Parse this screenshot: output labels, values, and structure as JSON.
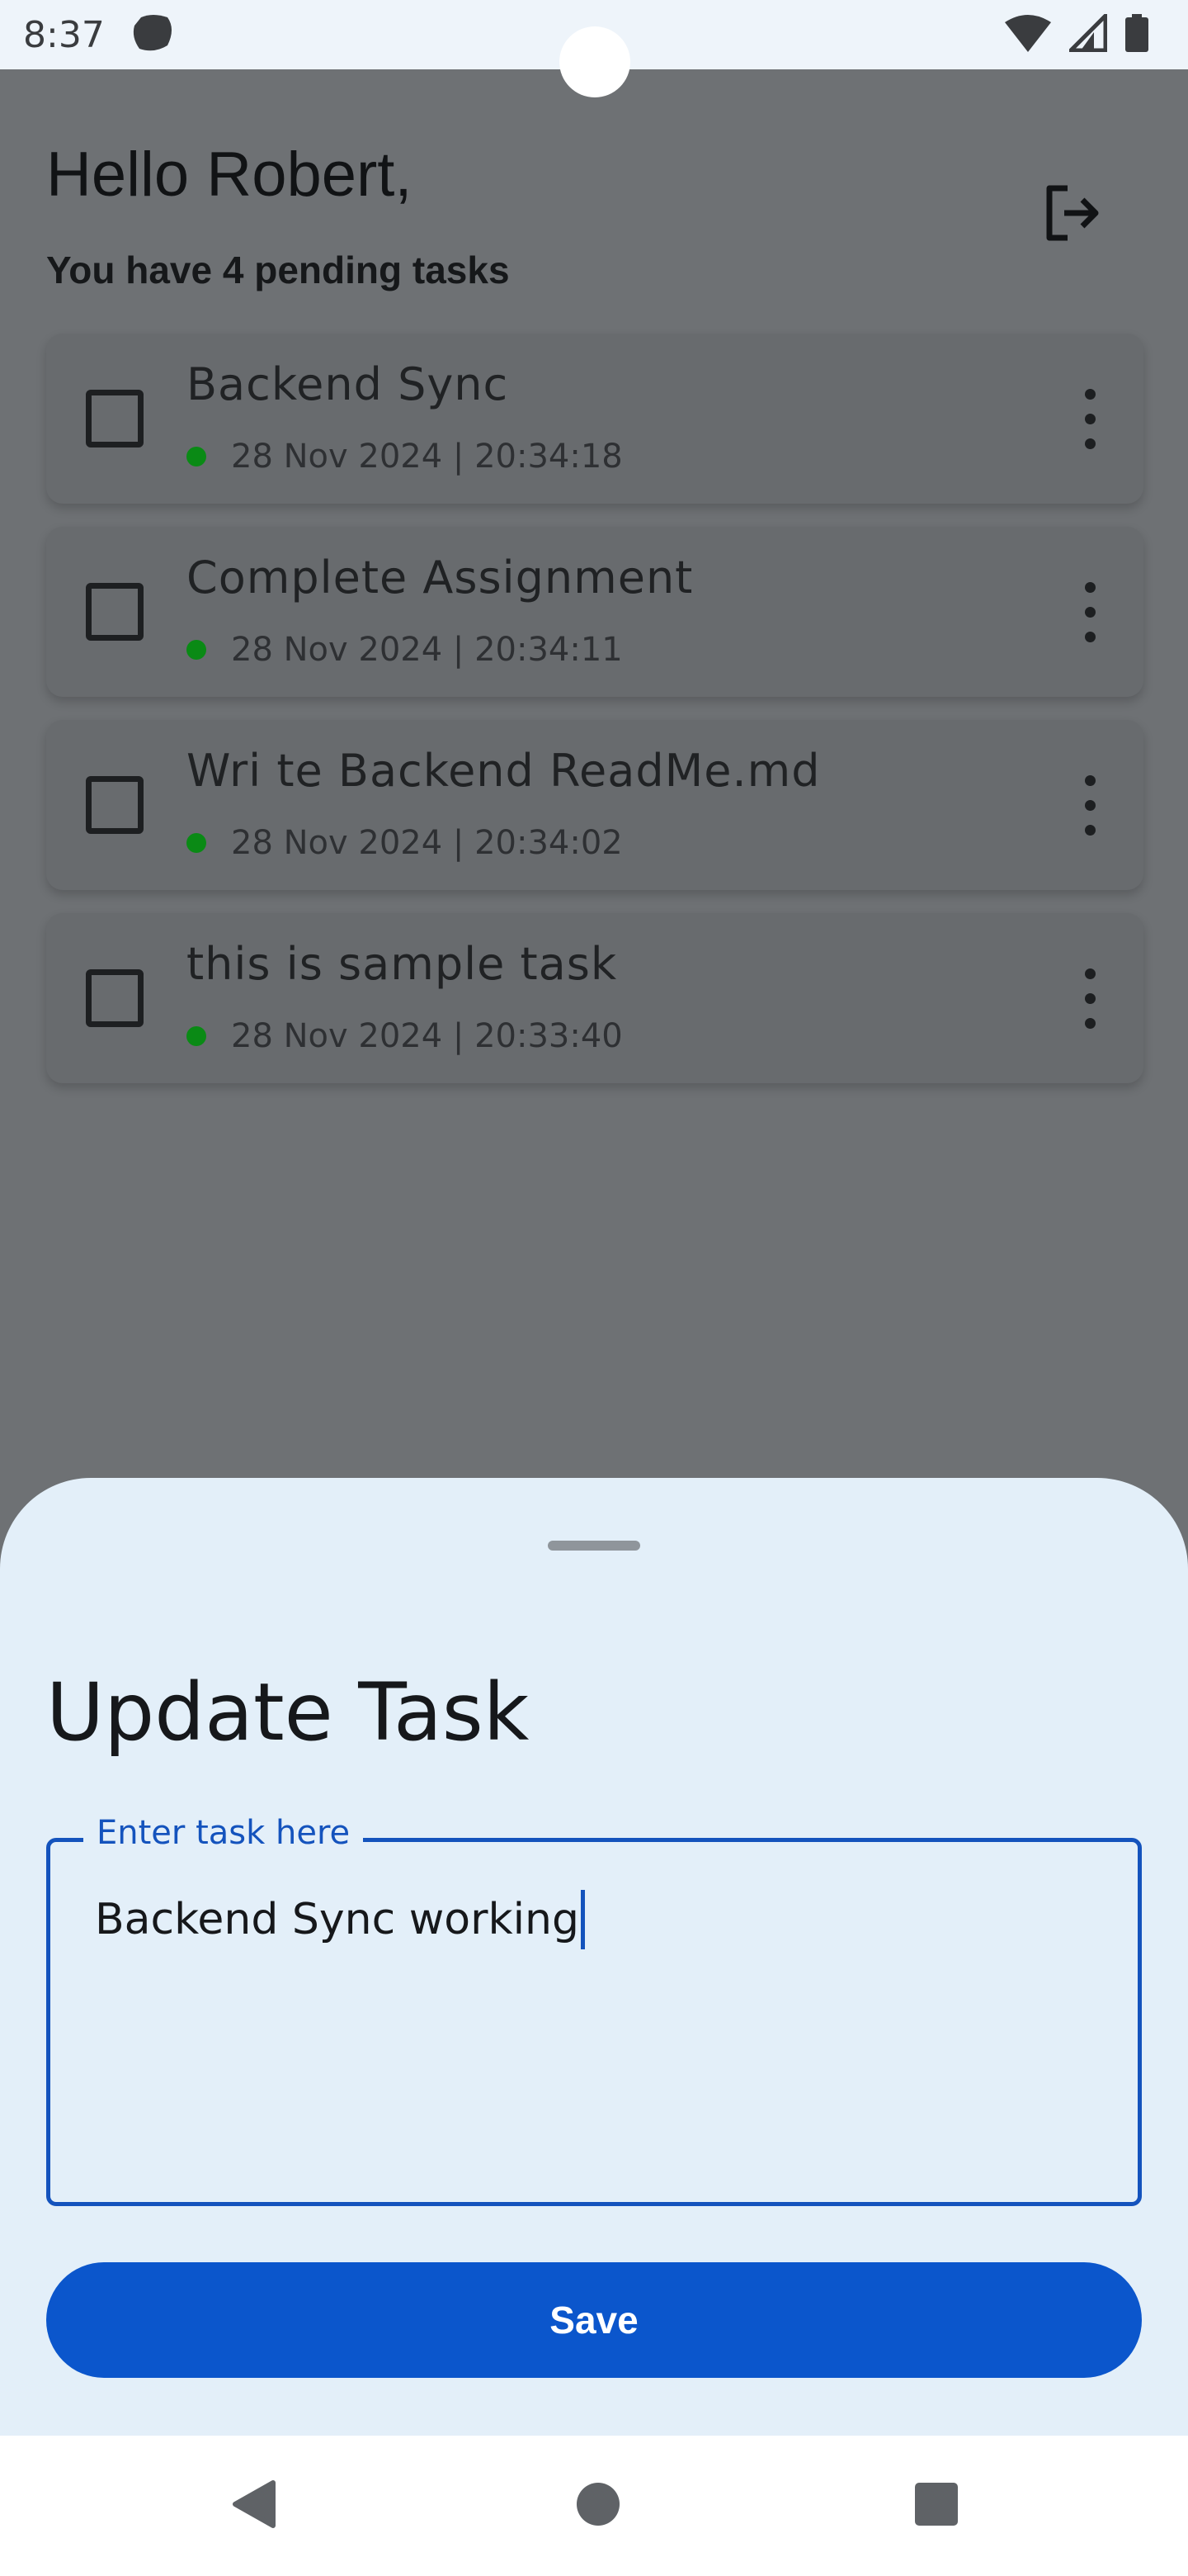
{
  "status_bar": {
    "time": "8:37"
  },
  "header": {
    "greeting": "Hello Robert,",
    "pending_text": "You have 4 pending tasks"
  },
  "tasks": [
    {
      "title": "Backend Sync",
      "timestamp": "28 Nov 2024 | 20:34:18"
    },
    {
      "title": "Complete Assignment",
      "timestamp": "28 Nov 2024 | 20:34:11"
    },
    {
      "title": "Wri te Backend ReadMe.md",
      "timestamp": "28 Nov 2024 | 20:34:02"
    },
    {
      "title": "this is sample task",
      "timestamp": "28 Nov 2024 | 20:33:40"
    }
  ],
  "sheet": {
    "title": "Update Task",
    "field_label": "Enter task here",
    "field_value": "Backend Sync working",
    "save_label": "Save"
  },
  "colors": {
    "accent": "#0b56cc",
    "status_dot": "#0a8a15",
    "sheet_bg": "#e3eff9"
  }
}
